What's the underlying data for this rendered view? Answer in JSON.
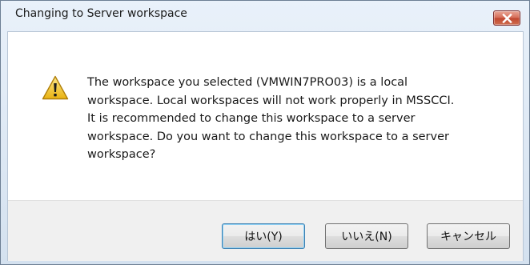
{
  "window": {
    "title": "Changing to Server workspace",
    "close_label": "Close"
  },
  "dialog": {
    "icon": "warning-icon",
    "message": "The workspace you selected (VMWIN7PRO03) is a local\nworkspace. Local workspaces will not work properly in MSSCCI.\nIt is recommended to change this workspace to a server\nworkspace. Do you want to change this workspace to a server\nworkspace?"
  },
  "buttons": {
    "yes_label": "はい(Y)",
    "no_label": "いいえ(N)",
    "cancel_label": "キャンセル"
  },
  "colors": {
    "title_bar": "#d4e1ef",
    "close_button": "#c0452f",
    "default_button_border": "#3c7fb1",
    "warning_fill": "#f2c521"
  }
}
